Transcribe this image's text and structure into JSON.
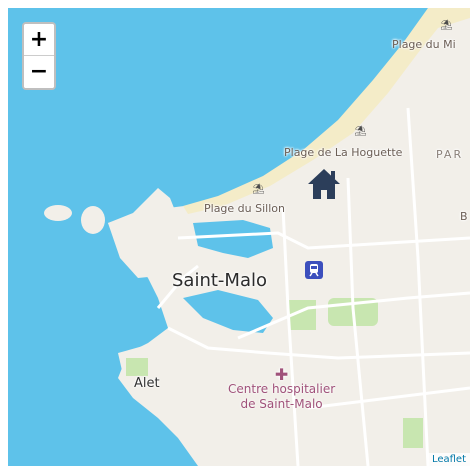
{
  "map": {
    "zoom_in_label": "+",
    "zoom_out_label": "−",
    "labels": {
      "plage_du_mi": "Plage du Mi",
      "plage_hoguette": "Plage de La Hoguette",
      "par": "PAR",
      "plage_sillon": "Plage du Sillon",
      "b": "B",
      "city": "Saint-Malo",
      "hospital_line1": "Centre hospitalier",
      "hospital_line2": "de Saint-Malo",
      "alet": "Alet"
    },
    "attribution": "Leaflet",
    "colors": {
      "sea": "#5ec2ea",
      "land": "#f2efe9",
      "beach": "#f4ecc8",
      "park": "#c8e6b0",
      "marker": "#2c3e5a",
      "hospital": "#a0527a",
      "station": "#3c4fbd"
    },
    "icons": [
      "home-marker-icon",
      "train-station-icon",
      "hospital-icon",
      "beach-umbrella-icon"
    ]
  }
}
